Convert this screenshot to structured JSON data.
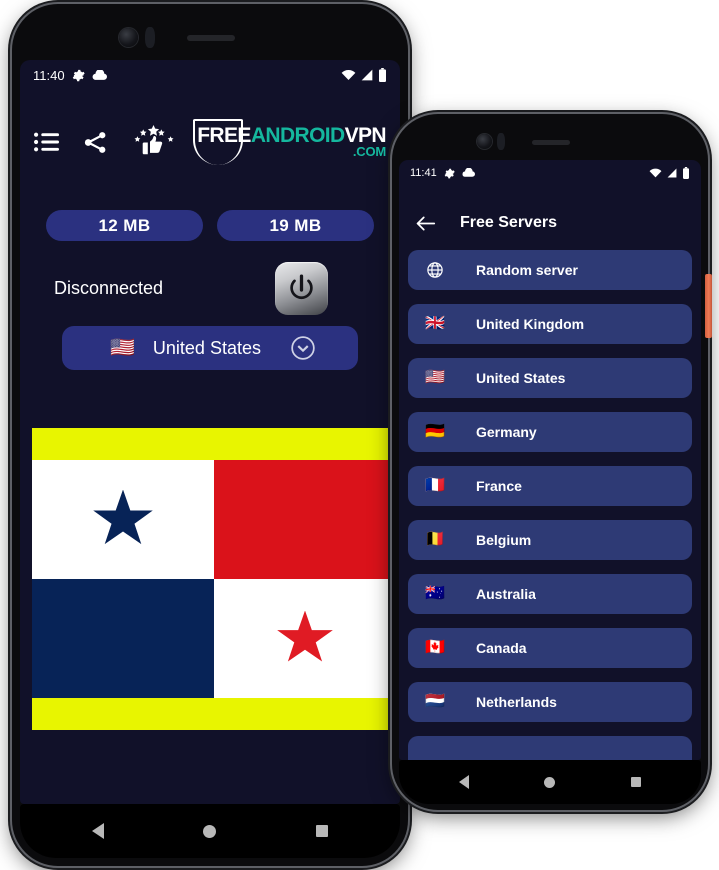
{
  "phone1": {
    "status_bar": {
      "time": "11:40",
      "left_icons": [
        "gear-icon",
        "cloud-icon"
      ],
      "right_icons": [
        "wifi-icon",
        "signal-icon",
        "battery-icon"
      ]
    },
    "toolbar": {
      "icons": [
        {
          "name": "list-icon",
          "label": "List"
        },
        {
          "name": "share-icon",
          "label": "Share"
        },
        {
          "name": "rate-icon",
          "label": "Rate"
        }
      ]
    },
    "logo": {
      "free": "FREE",
      "android": "ANDROID",
      "vpn": "VPN",
      "dotcom": ".COM"
    },
    "badges": [
      {
        "name": "download-badge",
        "value": "12 MB"
      },
      {
        "name": "upload-badge",
        "value": "19 MB"
      }
    ],
    "connection": {
      "status": "Disconnected",
      "power_button": "power-icon"
    },
    "server_select": {
      "flag": "🇺🇸",
      "label": "United States",
      "chevron": "chevron-down-icon"
    },
    "banner": {
      "name": "panama-flag-banner",
      "top_bar_color": "#e8f500",
      "bottom_bar_color": "#e8f500",
      "quadrants": [
        "white-with-blue-star",
        "red",
        "blue",
        "white-with-red-star"
      ]
    },
    "navigation": [
      "back",
      "home",
      "recents"
    ]
  },
  "phone2": {
    "status_bar": {
      "time": "11:41",
      "left_icons": [
        "gear-icon",
        "cloud-icon"
      ],
      "right_icons": [
        "wifi-icon",
        "signal-icon",
        "battery-icon"
      ]
    },
    "appbar": {
      "back": "arrow-left-icon",
      "title": "Free Servers"
    },
    "servers": [
      {
        "flag": "globe",
        "label": "Random server"
      },
      {
        "flag": "🇬🇧",
        "label": "United Kingdom"
      },
      {
        "flag": "🇺🇸",
        "label": "United States"
      },
      {
        "flag": "🇩🇪",
        "label": "Germany"
      },
      {
        "flag": "🇫🇷",
        "label": "France"
      },
      {
        "flag": "🇧🇪",
        "label": "Belgium"
      },
      {
        "flag": "🇦🇺",
        "label": "Australia"
      },
      {
        "flag": "🇨🇦",
        "label": "Canada"
      },
      {
        "flag": "🇳🇱",
        "label": "Netherlands"
      }
    ],
    "navigation": [
      "back",
      "home",
      "recents"
    ],
    "side_button_color": "#e8734f"
  },
  "colors": {
    "screen_background": "#111129",
    "accent_panel": "#2b3180",
    "list_item": "#2e3a75",
    "logo_teal": "#15b79e",
    "banner_yellow": "#e8f500"
  }
}
